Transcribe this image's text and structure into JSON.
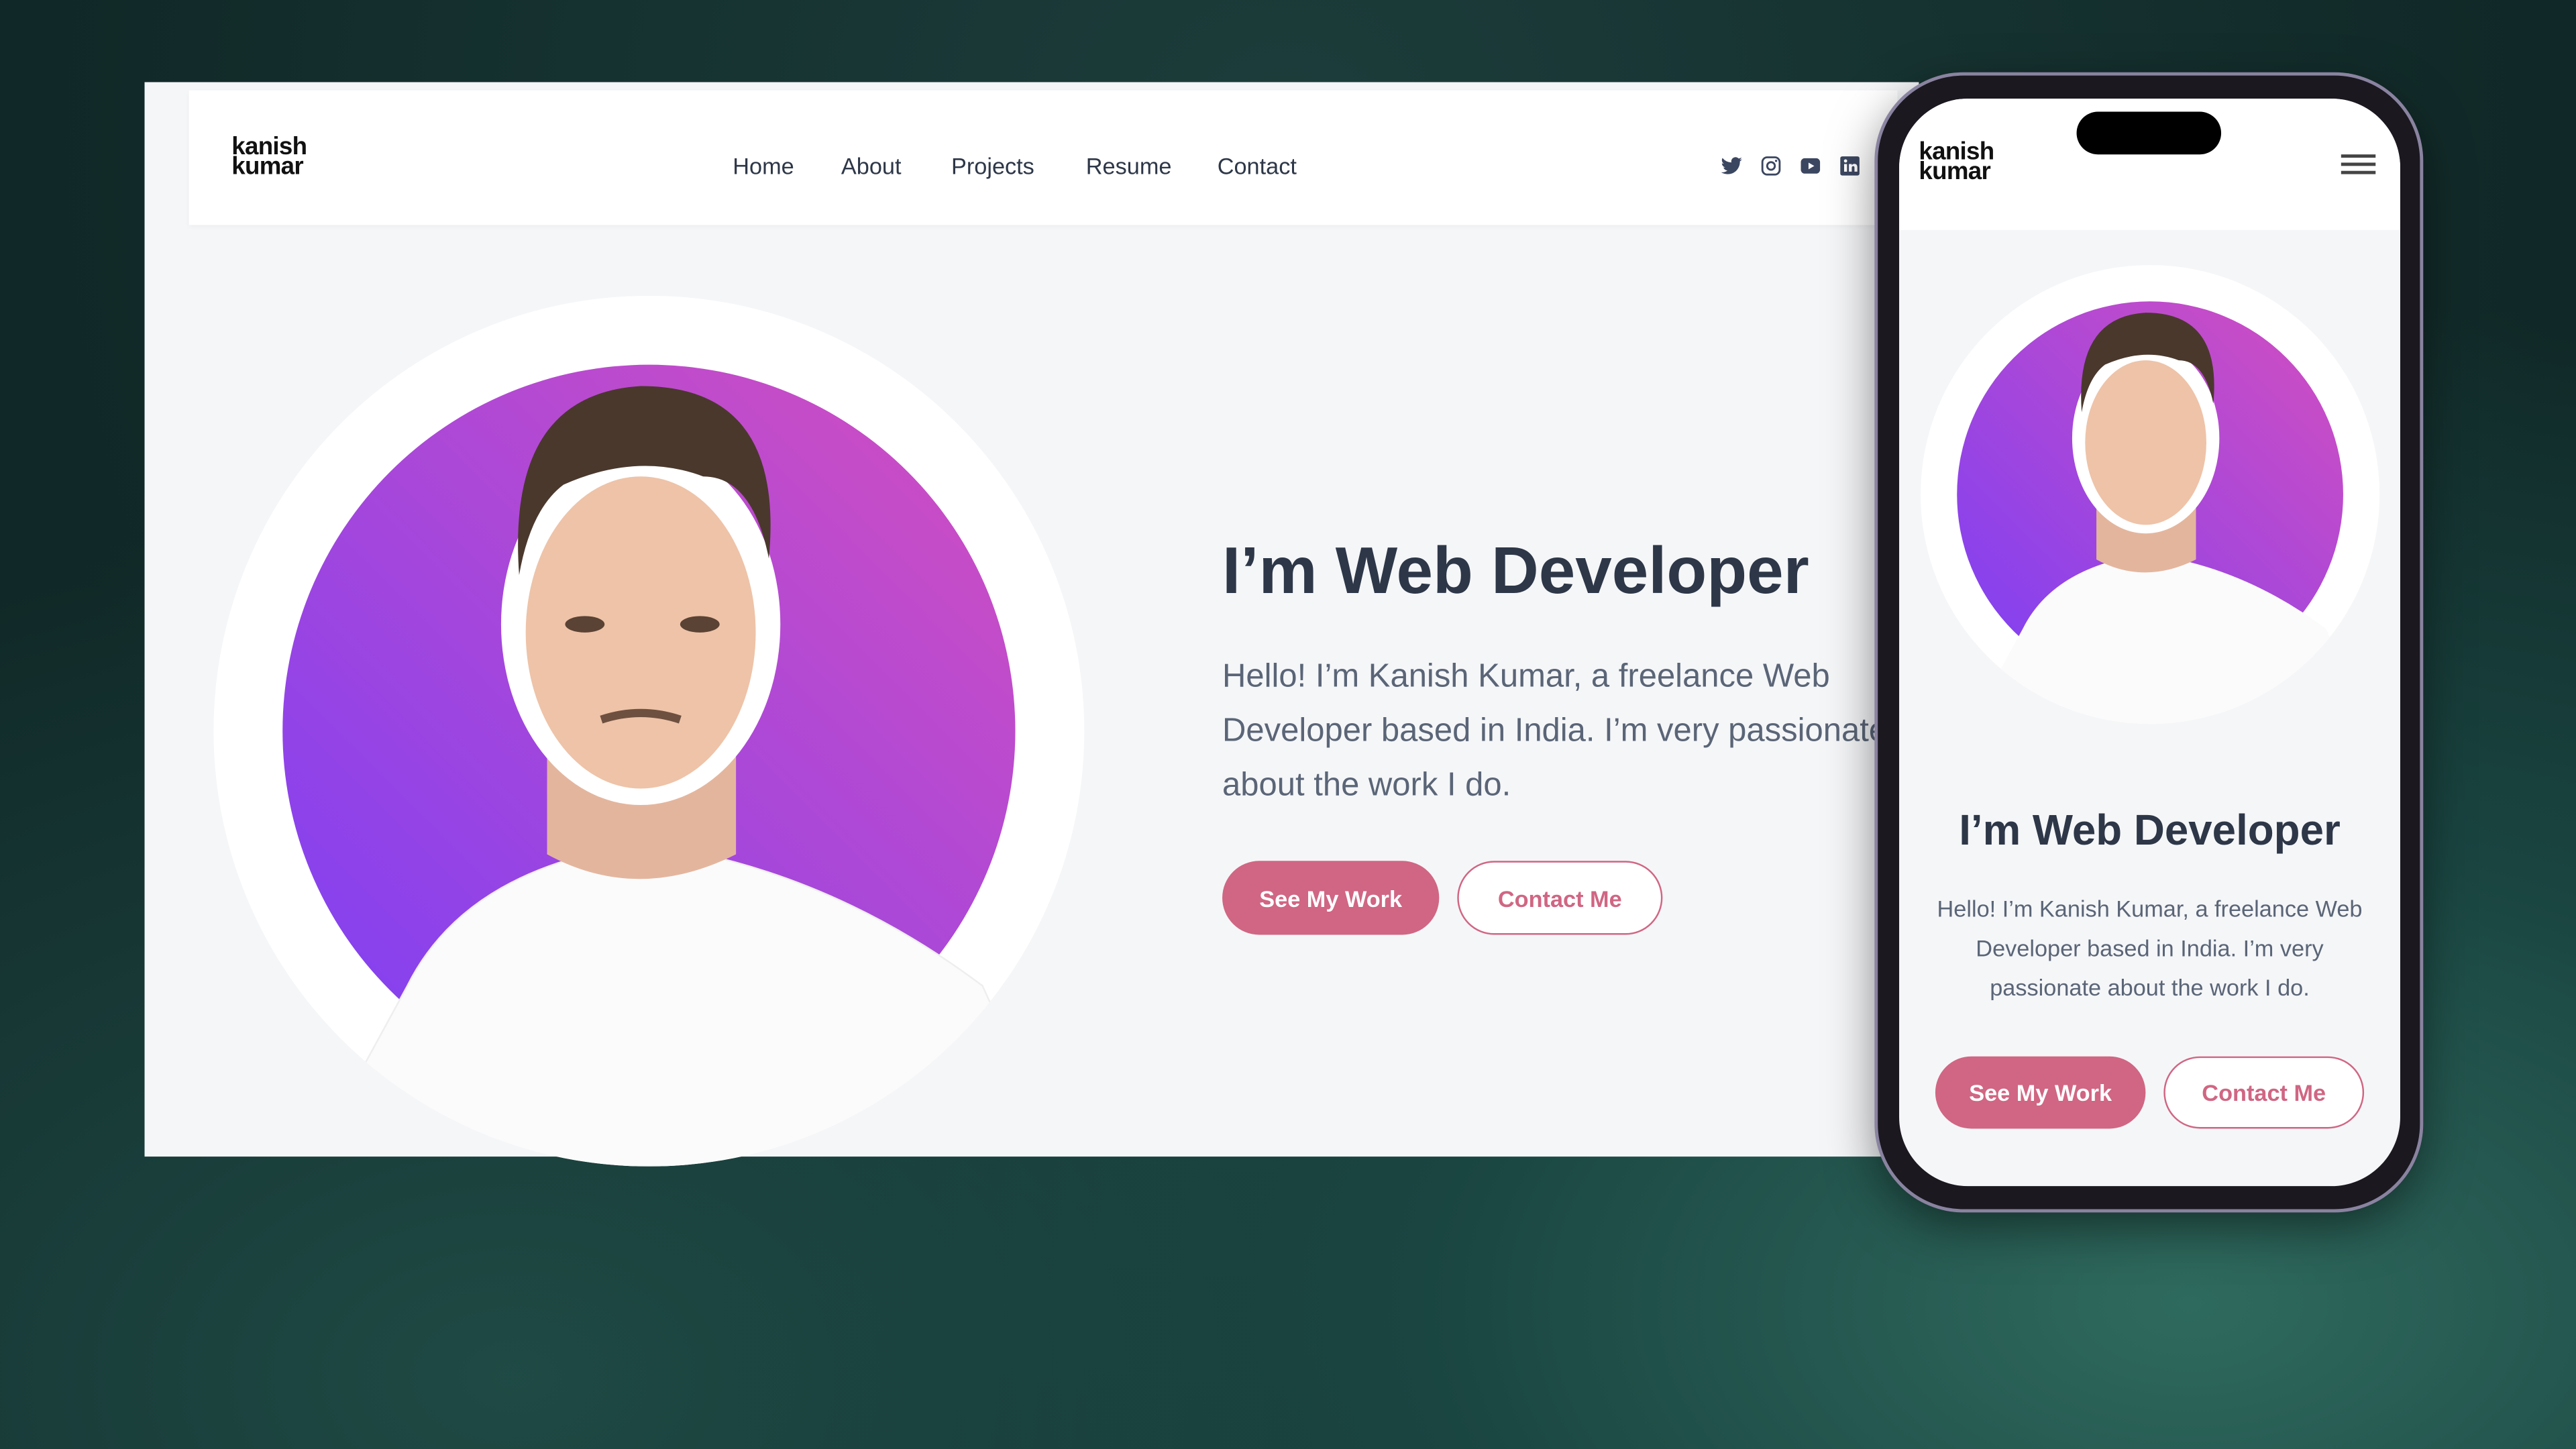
{
  "brand": {
    "line1": "kanish",
    "line2": "kumar"
  },
  "nav": [
    "Home",
    "About",
    "Projects",
    "Resume",
    "Contact"
  ],
  "social_icons": [
    "twitter-icon",
    "instagram-icon",
    "youtube-icon",
    "linkedin-icon"
  ],
  "hero": {
    "title": "I’m Web Developer",
    "desktop_lines": [
      "Hello! I’m Kanish Kumar, a freelance Web",
      "Developer based in India. I’m very passionate",
      "about the work I do."
    ],
    "mobile_lines": [
      "Hello! I’m Kanish Kumar, a freelance Web",
      "Developer based in India. I’m very",
      "passionate about the work I do."
    ],
    "primary_button": "See My Work",
    "secondary_button": "Contact Me"
  },
  "colors": {
    "accent": "#d06683",
    "heading": "#2d3748",
    "gradient_start": "#7b3ff5",
    "gradient_end": "#d44fbf"
  }
}
